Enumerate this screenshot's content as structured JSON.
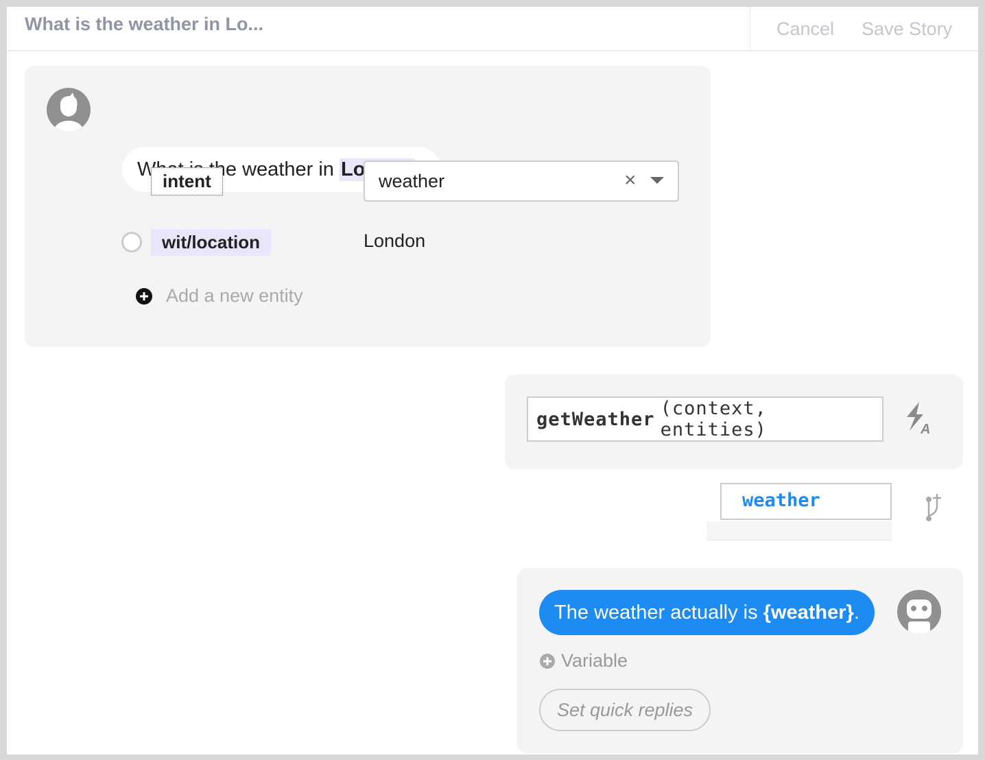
{
  "header": {
    "title": "What is the weather in Lo...",
    "cancel": "Cancel",
    "save": "Save Story"
  },
  "user": {
    "message_prefix": "What is the weather in ",
    "message_entity": "London",
    "message_suffix": "?",
    "intent_label": "intent",
    "intent_value": "weather",
    "entity_label": "wit/location",
    "entity_value": "London",
    "add_entity": "Add a new entity"
  },
  "action": {
    "function": "getWeather",
    "args": "(context, entities)",
    "context_key": "weather"
  },
  "bot": {
    "prefix": "The weather actually is ",
    "variable": "{weather}",
    "suffix": ".",
    "add_variable": "Variable",
    "quick_replies": "Set quick replies"
  },
  "colors": {
    "accent": "#1e8bf2",
    "entity_bg": "#e9e6fb",
    "card_bg": "#f4f4f4"
  }
}
